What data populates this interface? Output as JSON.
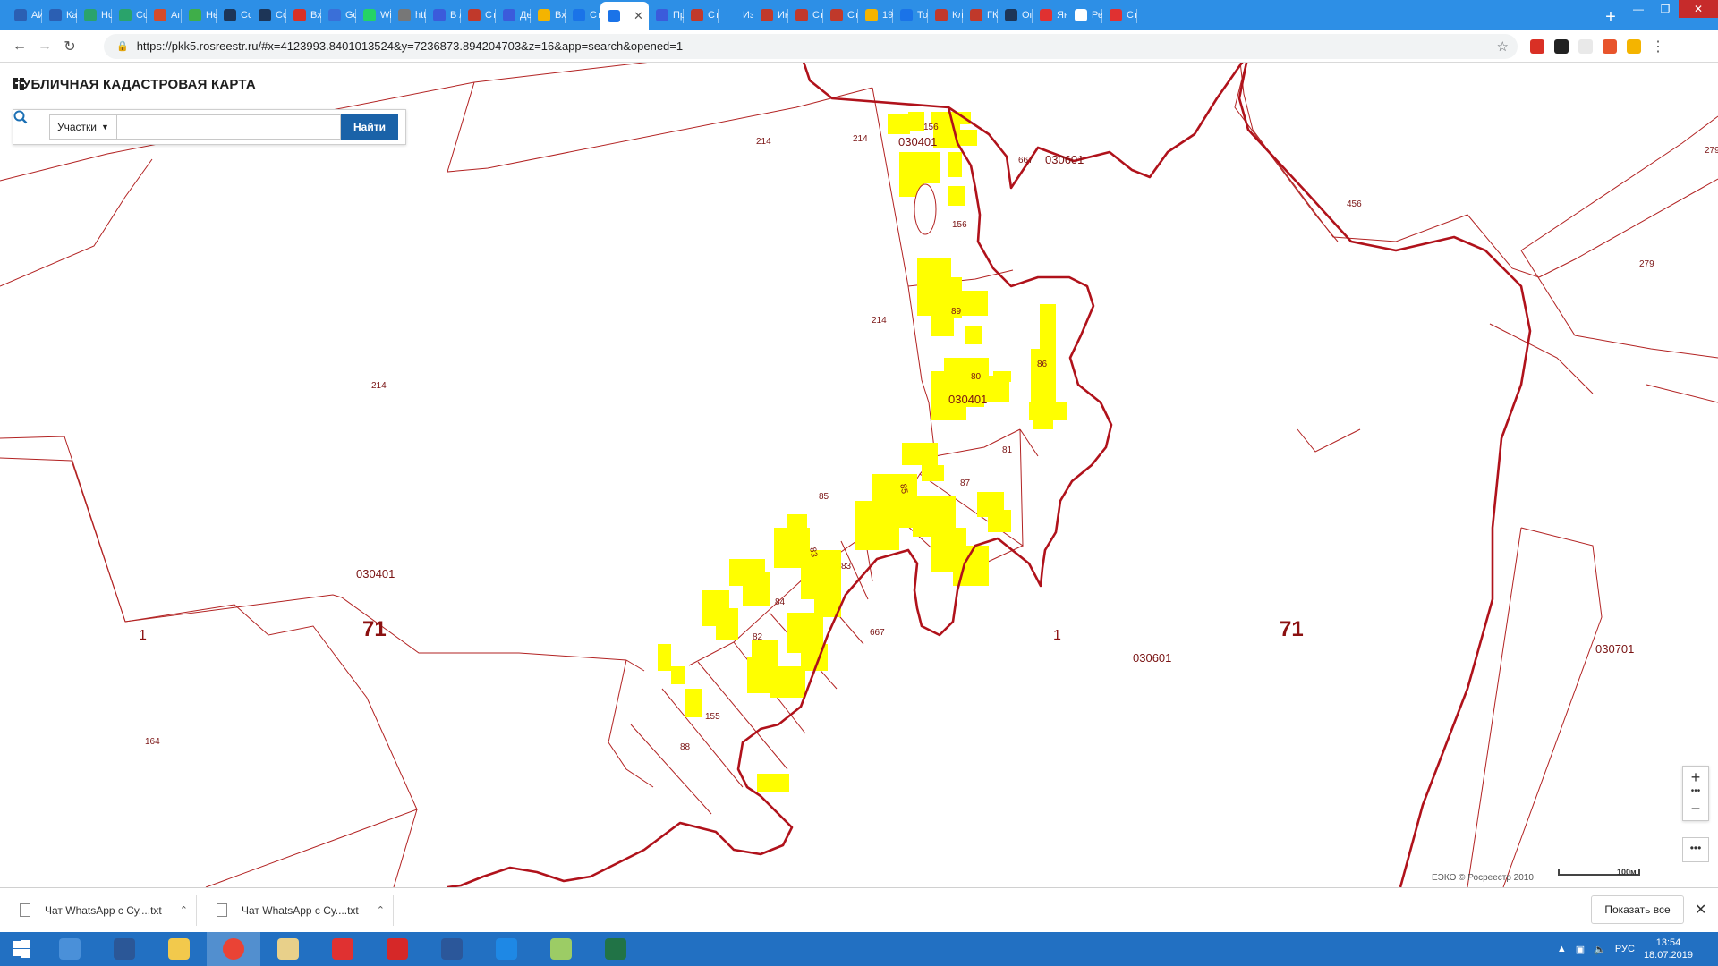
{
  "browser": {
    "tabs": [
      {
        "label": "АИ",
        "color": "#2b5fb3"
      },
      {
        "label": "Ка",
        "color": "#2b5fb3"
      },
      {
        "label": "Нс",
        "color": "#2aa36b"
      },
      {
        "label": "Со",
        "color": "#2aa36b"
      },
      {
        "label": "Аг",
        "color": "#d44b2b"
      },
      {
        "label": "Не",
        "color": "#3fae49"
      },
      {
        "label": "Со",
        "color": "#1d3557"
      },
      {
        "label": "Со",
        "color": "#1d3557"
      },
      {
        "label": "Вх",
        "color": "#d93025"
      },
      {
        "label": "Gc",
        "color": "#3a6fd8"
      },
      {
        "label": "Wi",
        "color": "#25d366"
      },
      {
        "label": "htt",
        "color": "#777777"
      },
      {
        "label": "В /",
        "color": "#3b5bdb"
      },
      {
        "label": "Ст",
        "color": "#c0392b"
      },
      {
        "label": "Де",
        "color": "#3b5bdb"
      },
      {
        "label": "Вх",
        "color": "#f4b400"
      },
      {
        "label": "Ст",
        "color": "#1a73e8"
      },
      {
        "label": "",
        "color": "#1a73e8",
        "active": true
      },
      {
        "label": "Пр",
        "color": "#3b5bdb"
      },
      {
        "label": "Ст",
        "color": "#c0392b"
      },
      {
        "label": "Из",
        "color": "#2d8fe6"
      },
      {
        "label": "Ин",
        "color": "#c0392b"
      },
      {
        "label": "Ст",
        "color": "#c0392b"
      },
      {
        "label": "Ст",
        "color": "#c0392b"
      },
      {
        "label": "19",
        "color": "#f4b400"
      },
      {
        "label": "То",
        "color": "#1a73e8"
      },
      {
        "label": "Кл",
        "color": "#c0392b"
      },
      {
        "label": "ГК",
        "color": "#c0392b"
      },
      {
        "label": "Ог",
        "color": "#1d3557"
      },
      {
        "label": "Ян",
        "color": "#e03131"
      },
      {
        "label": "Ре",
        "color": "#ffffff"
      },
      {
        "label": "Ст",
        "color": "#e03131"
      }
    ],
    "new_tab_label": "+",
    "url": "https://pkk5.rosreestr.ru/#x=4123993.8401013524&y=7236873.894204703&z=16&app=search&opened=1",
    "extension_colors": [
      "#d93025",
      "#222222",
      "#e9e9e9",
      "#e8542c",
      "#f4b400"
    ]
  },
  "app": {
    "title": "ПУБЛИЧНАЯ КАДАСТРОВАЯ КАРТА",
    "search": {
      "type_label": "Участки",
      "find_label": "Найти",
      "placeholder": ""
    }
  },
  "map": {
    "labels": [
      {
        "text": "214",
        "cls": "sm"
      },
      {
        "text": "214",
        "cls": "sm"
      },
      {
        "text": "156",
        "cls": "sm"
      },
      {
        "text": "030401",
        "cls": "md"
      },
      {
        "text": "667",
        "cls": "sm"
      },
      {
        "text": "030601",
        "cls": "md"
      },
      {
        "text": "156",
        "cls": "sm"
      },
      {
        "text": "456",
        "cls": "sm"
      },
      {
        "text": "279",
        "cls": "sm"
      },
      {
        "text": "279",
        "cls": "sm"
      },
      {
        "text": "214",
        "cls": "sm"
      },
      {
        "text": "89",
        "cls": "sm"
      },
      {
        "text": "86",
        "cls": "sm"
      },
      {
        "text": "214",
        "cls": "sm"
      },
      {
        "text": "80",
        "cls": "sm"
      },
      {
        "text": "030401",
        "cls": "md"
      },
      {
        "text": "81",
        "cls": "sm"
      },
      {
        "text": "87",
        "cls": "sm"
      },
      {
        "text": "85",
        "cls": "sm"
      },
      {
        "text": "85",
        "cls": "sm"
      },
      {
        "text": "83",
        "cls": "sm"
      },
      {
        "text": "83",
        "cls": "sm"
      },
      {
        "text": "84",
        "cls": "sm"
      },
      {
        "text": "030401",
        "cls": "md"
      },
      {
        "text": "82",
        "cls": "sm"
      },
      {
        "text": "667",
        "cls": "sm"
      },
      {
        "text": "1",
        "cls": "mid"
      },
      {
        "text": "71",
        "cls": "lg"
      },
      {
        "text": "1",
        "cls": "mid"
      },
      {
        "text": "71",
        "cls": "lg"
      },
      {
        "text": "030601",
        "cls": "md"
      },
      {
        "text": "030701",
        "cls": "md"
      },
      {
        "text": "155",
        "cls": "sm"
      },
      {
        "text": "164",
        "cls": "sm"
      },
      {
        "text": "88",
        "cls": "sm"
      }
    ],
    "attribution": "ЕЭКО © Росреестр 2010",
    "scale_label": "100м",
    "zoom_in": "+",
    "zoom_out": "−",
    "more": "•••",
    "colors": {
      "boundary": "#b22222",
      "river": "#b0121b",
      "buildings": "#ffff00"
    }
  },
  "downloads": {
    "items": [
      {
        "name": "Чат WhatsApp с Су....txt"
      },
      {
        "name": "Чат WhatsApp с Су....txt"
      }
    ],
    "show_all": "Показать все"
  },
  "taskbar": {
    "apps": [
      {
        "name": "file-manager",
        "color": "#4a90d9"
      },
      {
        "name": "powershell",
        "color": "#2b5797"
      },
      {
        "name": "explorer",
        "color": "#f2c94c"
      },
      {
        "name": "chrome",
        "color": "#ea4335",
        "active": true
      },
      {
        "name": "certificate",
        "color": "#e8d08a"
      },
      {
        "name": "app-red",
        "color": "#e03131"
      },
      {
        "name": "foxit",
        "color": "#d62828"
      },
      {
        "name": "word",
        "color": "#2b579a"
      },
      {
        "name": "ie",
        "color": "#1e88e5"
      },
      {
        "name": "paint",
        "color": "#9ccc65"
      },
      {
        "name": "excel",
        "color": "#217346"
      }
    ],
    "language": "РУС",
    "time": "13:54",
    "date": "18.07.2019"
  }
}
